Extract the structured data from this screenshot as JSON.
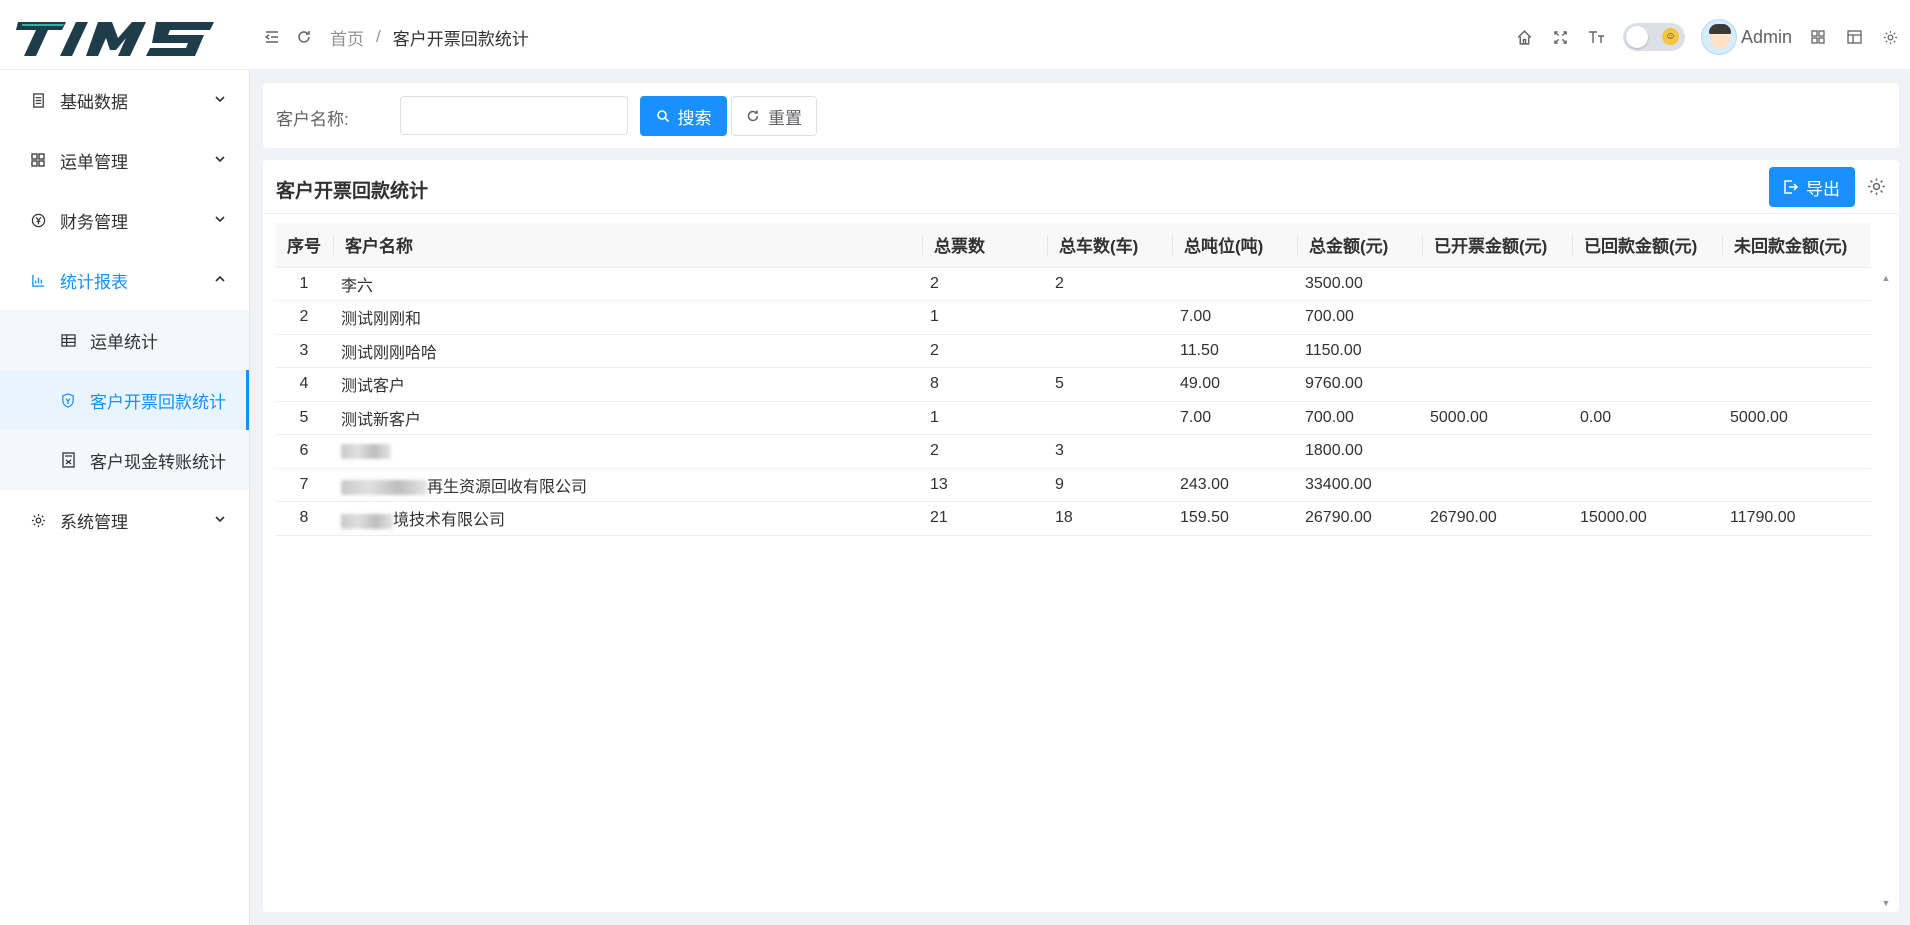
{
  "app": {
    "logo_text": "TIMS"
  },
  "header": {
    "breadcrumb": {
      "home": "首页",
      "separator": "/",
      "current": "客户开票回款统计"
    },
    "user_name": "Admin"
  },
  "sidebar": {
    "items": [
      {
        "label": "基础数据",
        "icon": "database-icon"
      },
      {
        "label": "运单管理",
        "icon": "grid-icon"
      },
      {
        "label": "财务管理",
        "icon": "yen-icon"
      },
      {
        "label": "统计报表",
        "icon": "chart-icon",
        "open": true,
        "children": [
          {
            "label": "运单统计",
            "icon": "table-icon"
          },
          {
            "label": "客户开票回款统计",
            "icon": "shield-icon",
            "active": true
          },
          {
            "label": "客户现金转账统计",
            "icon": "calculator-icon"
          }
        ]
      },
      {
        "label": "系统管理",
        "icon": "gear-icon"
      }
    ]
  },
  "search": {
    "label": "客户名称:",
    "value": "",
    "placeholder": "",
    "search_button": "搜索",
    "reset_button": "重置"
  },
  "table": {
    "title": "客户开票回款统计",
    "export_button": "导出",
    "columns": [
      "序号",
      "客户名称",
      "总票数",
      "总车数(车)",
      "总吨位(吨)",
      "总金额(元)",
      "已开票金额(元)",
      "已回款金额(元)",
      "未回款金额(元)"
    ],
    "rows": [
      [
        "1",
        "李六",
        "2",
        "2",
        "",
        "3500.00",
        "",
        "",
        ""
      ],
      [
        "2",
        "测试刚刚和",
        "1",
        "",
        "7.00",
        "700.00",
        "",
        "",
        ""
      ],
      [
        "3",
        "测试刚刚哈哈",
        "2",
        "",
        "11.50",
        "1150.00",
        "",
        "",
        ""
      ],
      [
        "4",
        "测试客户",
        "8",
        "5",
        "49.00",
        "9760.00",
        "",
        "",
        ""
      ],
      [
        "5",
        "测试新客户",
        "1",
        "",
        "7.00",
        "700.00",
        "5000.00",
        "0.00",
        "5000.00"
      ],
      [
        "6",
        "",
        "2",
        "3",
        "",
        "1800.00",
        "",
        "",
        ""
      ],
      [
        "7",
        "再生资源回收有限公司",
        "13",
        "9",
        "243.00",
        "33400.00",
        "",
        "",
        ""
      ],
      [
        "8",
        "境技术有限公司",
        "21",
        "18",
        "159.50",
        "26790.00",
        "26790.00",
        "15000.00",
        "11790.00"
      ]
    ],
    "redacted_prefix_rows": [
      5,
      6,
      7
    ]
  },
  "colors": {
    "primary": "#1890ff",
    "background": "#f0f2f5"
  }
}
